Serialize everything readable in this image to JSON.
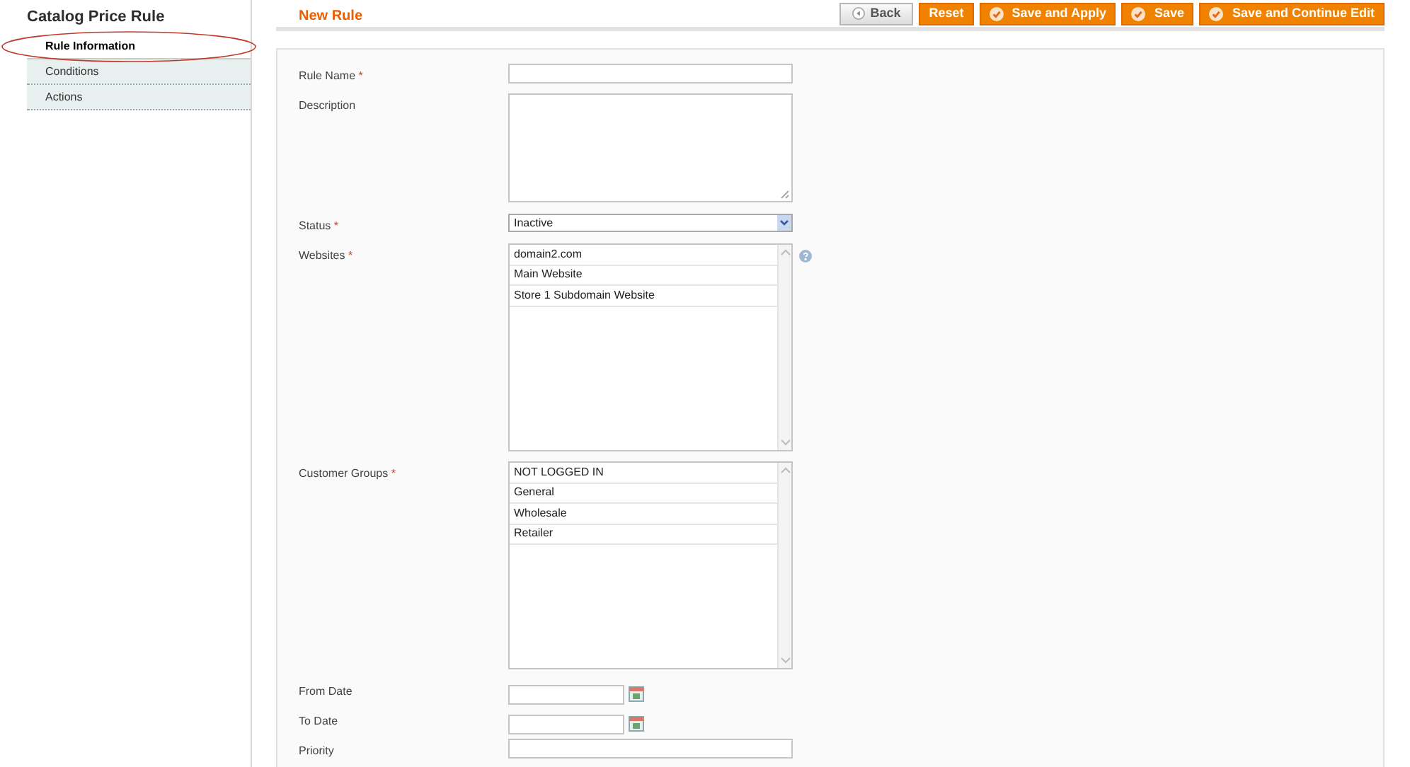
{
  "sidebar": {
    "title": "Catalog Price Rule",
    "tabs": [
      {
        "label": "Rule Information",
        "selected": true
      },
      {
        "label": "Conditions",
        "selected": false
      },
      {
        "label": "Actions",
        "selected": false
      }
    ]
  },
  "header": {
    "title": "New Rule",
    "buttons": [
      {
        "label": "Back",
        "kind": "back"
      },
      {
        "label": "Reset",
        "kind": "plain"
      },
      {
        "label": "Save and Apply",
        "kind": "check"
      },
      {
        "label": "Save",
        "kind": "check"
      },
      {
        "label": "Save and Continue Edit",
        "kind": "check"
      }
    ]
  },
  "fields": [
    {
      "label": "Rule Name",
      "required_mark": "*",
      "kind": "text",
      "help_icon": false
    },
    {
      "label": "Description",
      "kind": "textarea",
      "help_icon": false
    },
    {
      "label": "Status",
      "required_mark": "*",
      "kind": "select",
      "value": "Inactive",
      "help_icon": false
    },
    {
      "label": "Websites",
      "required_mark": "*",
      "kind": "multiselect",
      "help_icon": true,
      "options": [
        "domain2.com",
        "Main Website",
        "Store 1 Subdomain Website"
      ]
    },
    {
      "label": "Customer Groups",
      "required_mark": "*",
      "kind": "multiselect",
      "help_icon": false,
      "options": [
        "NOT LOGGED IN",
        "General",
        "Wholesale",
        "Retailer"
      ]
    },
    {
      "label": "From Date",
      "kind": "date",
      "help_icon": false
    },
    {
      "label": "To Date",
      "kind": "date",
      "help_icon": false
    },
    {
      "label": "Priority",
      "kind": "text",
      "help_icon": false
    }
  ]
}
